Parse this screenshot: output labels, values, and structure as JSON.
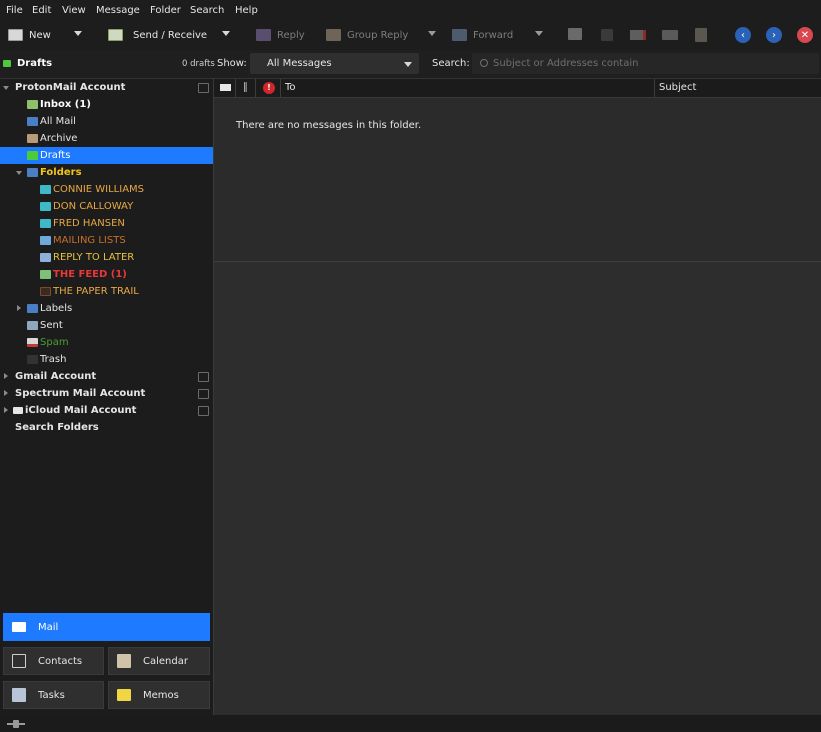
{
  "menu": [
    "File",
    "Edit",
    "View",
    "Message",
    "Folder",
    "Search",
    "Help"
  ],
  "toolbar": {
    "new": "New",
    "send_receive": "Send / Receive",
    "reply": "Reply",
    "group_reply": "Group Reply",
    "forward": "Forward"
  },
  "header": {
    "folder_title": "Drafts",
    "count": "0 drafts",
    "show_label": "Show:",
    "show_value": "All Messages",
    "search_label": "Search:",
    "search_placeholder": "Subject or Addresses contain"
  },
  "sidebar": {
    "items": [
      {
        "label": "ProtonMail Account",
        "color": "#e6e6e6",
        "bold": true
      },
      {
        "label": "Inbox (1)",
        "color": "#ffffff",
        "bold": true
      },
      {
        "label": "All Mail",
        "color": "#e6e6e6"
      },
      {
        "label": "Archive",
        "color": "#e6e6e6"
      },
      {
        "label": "Drafts",
        "color": "#ffffff"
      },
      {
        "label": "Folders",
        "color": "#f0c419",
        "bold": true
      },
      {
        "label": "CONNIE WILLIAMS",
        "color": "#e8a845"
      },
      {
        "label": "DON CALLOWAY",
        "color": "#e8a845"
      },
      {
        "label": "FRED HANSEN",
        "color": "#e8a845"
      },
      {
        "label": "MAILING LISTS",
        "color": "#c8702c"
      },
      {
        "label": "REPLY TO LATER",
        "color": "#e8c23a"
      },
      {
        "label": "THE FEED (1)",
        "color": "#e8383a",
        "bold": true
      },
      {
        "label": "THE PAPER TRAIL",
        "color": "#e8a845"
      },
      {
        "label": "Labels",
        "color": "#e6e6e6"
      },
      {
        "label": "Sent",
        "color": "#e6e6e6"
      },
      {
        "label": "Spam",
        "color": "#4aa034"
      },
      {
        "label": "Trash",
        "color": "#e6e6e6"
      },
      {
        "label": "Gmail Account",
        "color": "#e6e6e6",
        "bold": true
      },
      {
        "label": "Spectrum Mail Account",
        "color": "#e6e6e6",
        "bold": true
      },
      {
        "label": "iCloud Mail Account",
        "color": "#e6e6e6",
        "bold": true
      },
      {
        "label": "Search Folders",
        "color": "#e6e6e6",
        "bold": true
      }
    ]
  },
  "columns": {
    "to": "To",
    "subject": "Subject"
  },
  "empty_message": "There are no messages in this folder.",
  "nav": {
    "mail": "Mail",
    "contacts": "Contacts",
    "calendar": "Calendar",
    "tasks": "Tasks",
    "memos": "Memos"
  },
  "colors": {
    "accent": "#1e7bff"
  }
}
